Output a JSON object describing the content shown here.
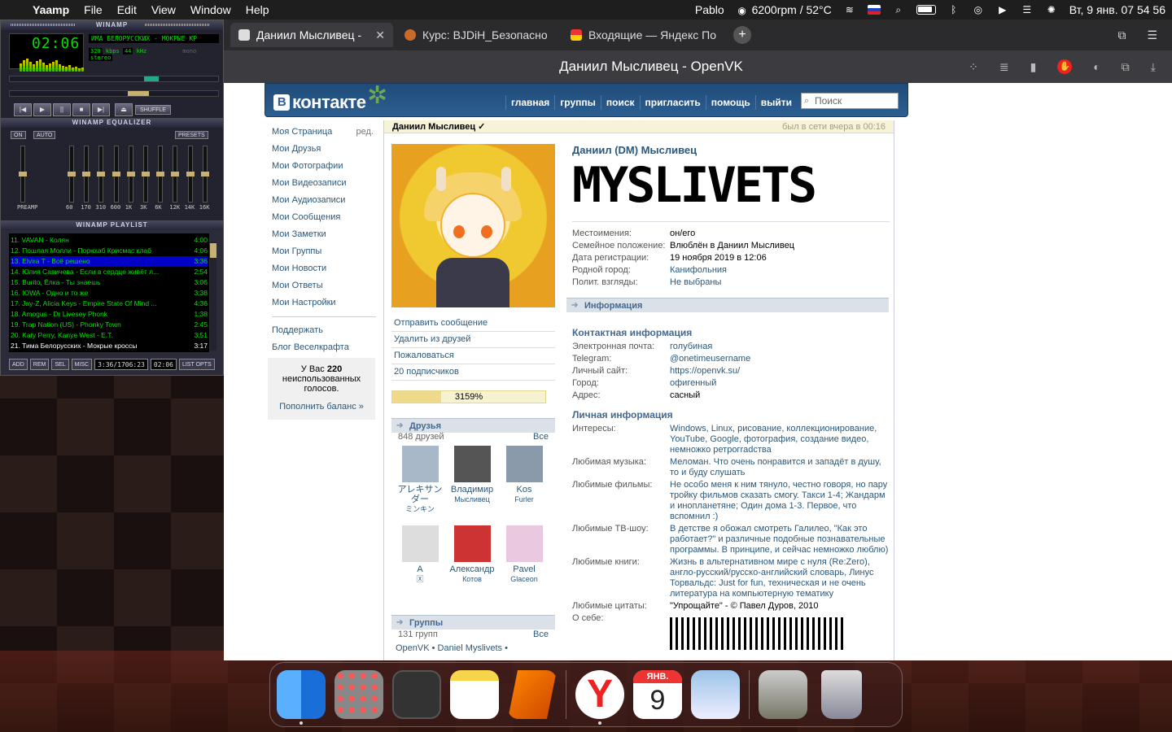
{
  "menubar": {
    "app_name": "Yaamp",
    "menus": [
      "File",
      "Edit",
      "View",
      "Window",
      "Help"
    ],
    "user": "Pablo",
    "fan_status": "6200rpm / 52°C",
    "datetime": "Вт, 9 янв.  07 54 56"
  },
  "winamp": {
    "title": "WINAMP",
    "time": "02:06",
    "song": "ИМА БЕЛОРУССКИХ - МОКРЫЕ КР",
    "kbps": "320",
    "khz": "44",
    "mono": "mono",
    "stereo": "stereo",
    "shuffle": "SHUFFLE",
    "eq_title": "WINAMP EQUALIZER",
    "eq_on": "ON",
    "eq_auto": "AUTO",
    "eq_presets": "PRESETS",
    "eq_labels": [
      "PREAMP",
      "60",
      "170",
      "310",
      "600",
      "1K",
      "3K",
      "6K",
      "12K",
      "14K",
      "16K"
    ],
    "playlist_title": "WINAMP PLAYLIST",
    "playlist": [
      {
        "name": "11. VAVAN - Колян",
        "time": "4:00"
      },
      {
        "name": "12. Пошлая Молли - Порнхаб Крисмас клаб",
        "time": "4:06"
      },
      {
        "name": "13. Elvira T - Всё решено",
        "time": "3:36"
      },
      {
        "name": "14. Юлия Савичева - Если в сердце живёт л...",
        "time": "2:54"
      },
      {
        "name": "15. Burito, Ёлка - Ты знаешь",
        "time": "3:06"
      },
      {
        "name": "16. IOWA - Одно и то же",
        "time": "3:38"
      },
      {
        "name": "17. Jay-Z, Alicia Keys - Empire State Of Mind ...",
        "time": "4:36"
      },
      {
        "name": "18. Amogus - Dr Livesey Phonk",
        "time": "1:38"
      },
      {
        "name": "19. Trap Nation (US) - Phonky Town",
        "time": "2:45"
      },
      {
        "name": "20. Katy Perry, Kanye West - E.T.",
        "time": "3:51"
      },
      {
        "name": "21. Тима Белорусских - Мокрые кроссы",
        "time": "3:17"
      }
    ],
    "pl_buttons": [
      "ADD",
      "REM",
      "SEL",
      "MISC"
    ],
    "pl_total": "3:36/1706:23",
    "pl_time": "02:06",
    "pl_list": "LIST OPTS"
  },
  "browser": {
    "tabs": [
      {
        "title": "Даниил Мысливец - OpenVK",
        "active": true
      },
      {
        "title": "Курс: BJDiH_Безопасно",
        "active": false
      },
      {
        "title": "Входящие — Яндекс По",
        "active": false
      }
    ],
    "window_title": "Даниил Мысливец - OpenVK"
  },
  "vk": {
    "logo": "контакте",
    "nav": [
      "главная",
      "группы",
      "поиск",
      "пригласить",
      "помощь",
      "выйти"
    ],
    "search_placeholder": "Поиск",
    "left_menu": [
      "Моя Страница",
      "Мои Друзья",
      "Мои Фотографии",
      "Мои Видеозаписи",
      "Мои Аудиозаписи",
      "Мои Сообщения",
      "Мои Заметки",
      "Мои Группы",
      "Мои Новости",
      "Мои Ответы",
      "Мои Настройки"
    ],
    "edit": "ред.",
    "left_extra": [
      "Поддержать",
      "Блог Веселкрафта"
    ],
    "votes_pre": "У Вас ",
    "votes_num": "220",
    "votes_post": "неиспользованных голосов.",
    "votes_link": "Пополнить баланс »",
    "page_name": "Даниил Мысливец ✓",
    "online": "был в сети вчера в 00:16",
    "actions": [
      "Отправить сообщение",
      "Удалить из друзей",
      "Пожаловаться",
      "20 подписчиков"
    ],
    "rating": "3159%",
    "rating_fill": 0.32,
    "friends_title": "Друзья",
    "friends_count": "848 друзей",
    "all": "Все",
    "friends": [
      {
        "first": "アレキサンダー",
        "last": "ミンキン"
      },
      {
        "first": "Владимир",
        "last": "Мысливец"
      },
      {
        "first": "Kos",
        "last": "Furler"
      },
      {
        "first": "A",
        "last": "🅇"
      },
      {
        "first": "Александр",
        "last": "Котов"
      },
      {
        "first": "Pavel",
        "last": "Glaceon"
      }
    ],
    "groups_title": "Группы",
    "groups_count": "131 групп",
    "groups_line": "OpenVK • Daniel Myslivets •",
    "full_name": "Даниил (DM) Мысливец",
    "pixel_name": "MYSLIVETS",
    "basic": [
      {
        "k": "Местоимения:",
        "v": "он/его",
        "link": false
      },
      {
        "k": "Семейное положение:",
        "v": "Влюблён в Даниил Мысливец",
        "link": false
      },
      {
        "k": "Дата регистрации:",
        "v": "19 ноября 2019 в 12:06",
        "link": false
      },
      {
        "k": "Родной город:",
        "v": "Канифольния",
        "link": true
      },
      {
        "k": "Полит. взгляды:",
        "v": "Не выбраны",
        "link": true
      }
    ],
    "info_title": "Информация",
    "contact_title": "Контактная информация",
    "contact": [
      {
        "k": "Электронная почта:",
        "v": "голубиная",
        "link": true
      },
      {
        "k": "Telegram:",
        "v": "@onetimeusername",
        "link": true
      },
      {
        "k": "Личный сайт:",
        "v": "https://openvk.su/",
        "link": true
      },
      {
        "k": "Город:",
        "v": "офигенный",
        "link": true
      },
      {
        "k": "Адрес:",
        "v": "сасный",
        "link": false
      }
    ],
    "personal_title": "Личная информация",
    "personal": [
      {
        "k": "Интересы:",
        "v": "Windows, Linux, рисование, коллекционирование, YouTube, Google, фотография, создание видео, немножко ретрогradства",
        "link": true
      },
      {
        "k": "Любимая музыка:",
        "v": "Меломан. Что очень понравится и западёт в душу, то и буду слушать",
        "link": true
      },
      {
        "k": "Любимые фильмы:",
        "v": "Не особо меня к ним тянуло, честно говоря, но пару тройку фильмов сказать смогу. Такси 1-4; Жандарм и инопланетяне; Один дома 1-3. Первое, что вспомнил :)",
        "link": true
      },
      {
        "k": "Любимые ТВ-шоу:",
        "v": "В детстве я обожал смотреть Галилео, \"Как это работает?\" и различные подобные познавательные программы. В принципе, и сейчас немножко люблю)",
        "link": true
      },
      {
        "k": "Любимые книги:",
        "v": "Жизнь в альтернативном мире с нуля (Re:Zero), англо-русский/русско-английский словарь, Линус Торвальдс: Just for fun, техническая и не очень литература на компьютерную тематику",
        "link": true
      },
      {
        "k": "Любимые цитаты:",
        "v": "\"Упрощайте\" - © Павел Дуров, 2010",
        "link": false
      },
      {
        "k": "О себе:",
        "v": "",
        "link": false
      }
    ]
  },
  "dock": {
    "calendar_month": "ЯНВ.",
    "calendar_day": "9"
  }
}
